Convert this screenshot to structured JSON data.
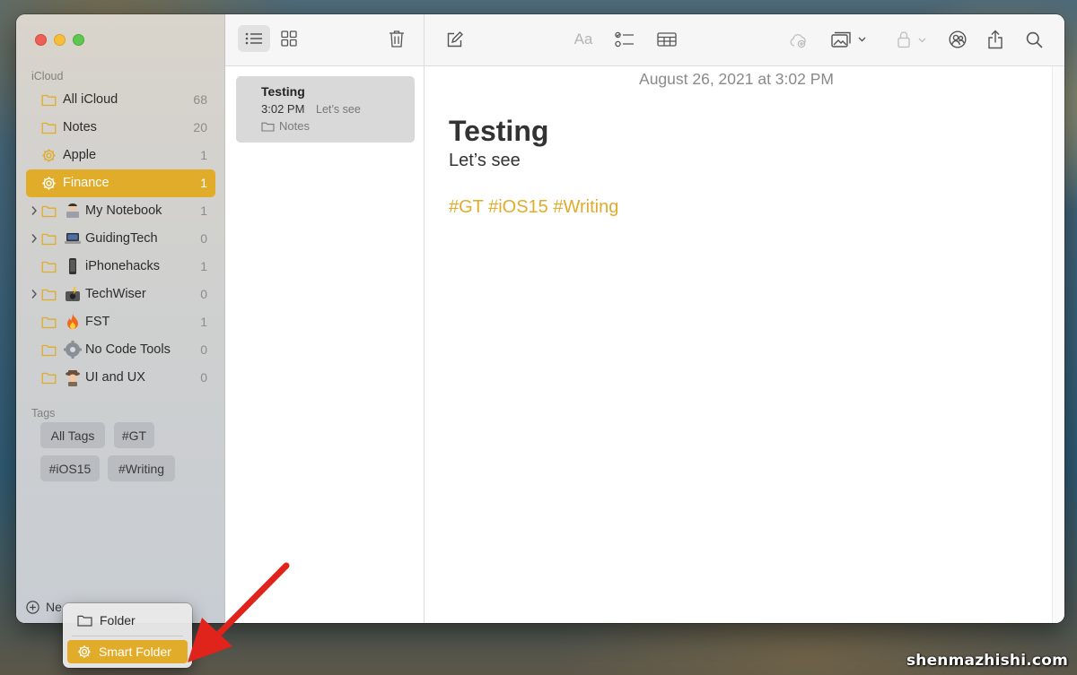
{
  "sidebar": {
    "icloud_label": "iCloud",
    "folders": [
      {
        "label": "All iCloud",
        "count": "68",
        "icon": "folder-icon",
        "emoji": null,
        "expandable": false,
        "selected": false
      },
      {
        "label": "Notes",
        "count": "20",
        "icon": "folder-icon",
        "emoji": null,
        "expandable": false,
        "selected": false
      },
      {
        "label": "Apple",
        "count": "1",
        "icon": "smart-folder-gear-icon",
        "emoji": null,
        "expandable": false,
        "selected": false
      },
      {
        "label": "Finance",
        "count": "1",
        "icon": "smart-folder-gear-icon",
        "emoji": null,
        "expandable": false,
        "selected": true
      },
      {
        "label": "My Notebook",
        "count": "1",
        "icon": "folder-icon",
        "emoji": "person-laptop-emoji",
        "expandable": true,
        "selected": false
      },
      {
        "label": "GuidingTech",
        "count": "0",
        "icon": "folder-icon",
        "emoji": "laptop-emoji",
        "expandable": true,
        "selected": false
      },
      {
        "label": "iPhonehacks",
        "count": "1",
        "icon": "folder-icon",
        "emoji": "mobile-phone-emoji",
        "expandable": false,
        "selected": false
      },
      {
        "label": "TechWiser",
        "count": "0",
        "icon": "folder-icon",
        "emoji": "camera-flash-emoji",
        "expandable": true,
        "selected": false
      },
      {
        "label": "FST",
        "count": "1",
        "icon": "folder-icon",
        "emoji": "fire-emoji",
        "expandable": false,
        "selected": false
      },
      {
        "label": "No Code Tools",
        "count": "0",
        "icon": "folder-icon",
        "emoji": "gear-emoji",
        "expandable": false,
        "selected": false
      },
      {
        "label": "UI and UX",
        "count": "0",
        "icon": "folder-icon",
        "emoji": "detective-emoji",
        "expandable": false,
        "selected": false
      }
    ],
    "tags_label": "Tags",
    "tags": [
      "All Tags",
      "#GT",
      "#iOS15",
      "#Writing"
    ],
    "new_folder_label": "Ne"
  },
  "note_list": {
    "notes": [
      {
        "title": "Testing",
        "time": "3:02 PM",
        "preview": "Let’s see",
        "folder": "Notes"
      }
    ]
  },
  "editor": {
    "date": "August 26, 2021 at 3:02 PM",
    "title": "Testing",
    "body": "Let’s see",
    "tags_line": "#GT #iOS15 #Writing"
  },
  "toolbar": {
    "icons": [
      "list-view-icon",
      "gallery-view-icon",
      "trash-icon",
      "compose-icon",
      "format-text-icon",
      "checklist-icon",
      "table-icon",
      "collaborate-icon",
      "media-icon",
      "lock-icon",
      "share-people-icon",
      "share-icon",
      "search-icon"
    ],
    "format_label": "Aa"
  },
  "popup_menu": {
    "items": [
      {
        "label": "Folder",
        "icon": "folder-icon",
        "active": false
      },
      {
        "label": "Smart Folder",
        "icon": "smart-folder-gear-icon",
        "active": true
      }
    ]
  },
  "colors": {
    "accent": "#e0ac2a",
    "annotation_arrow": "#e0231b"
  },
  "watermark": "shenmazhishi.com"
}
